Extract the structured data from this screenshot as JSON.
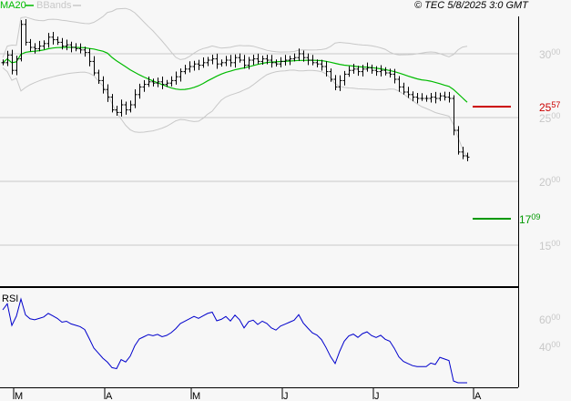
{
  "header": {
    "ma_label": "MA20",
    "bb_label": "BBands",
    "copyright": "© TEC 5/8/2025 3:0 GMT"
  },
  "colors": {
    "ma": "#00bb00",
    "bb": "#c8c8c8",
    "price": "#000000",
    "rsi": "#0000cc",
    "resistance": "#cc0000",
    "support": "#009900"
  },
  "chart_data": {
    "type": "bar",
    "title": "",
    "price_axis": [
      {
        "value": 3000,
        "main": "30",
        "dec": "00"
      },
      {
        "value": 2500,
        "main": "25",
        "dec": "00"
      },
      {
        "value": 2000,
        "main": "20",
        "dec": "00"
      },
      {
        "value": 1500,
        "main": "15",
        "dec": "00"
      }
    ],
    "rsi_axis": [
      {
        "value": 60,
        "main": "60",
        "dec": "00"
      },
      {
        "value": 40,
        "main": "40",
        "dec": "00"
      }
    ],
    "rsi_label": "RSI",
    "months": [
      {
        "label": "M",
        "index": 1
      },
      {
        "label": "A",
        "index": 21
      },
      {
        "label": "M",
        "index": 40
      },
      {
        "label": "J",
        "index": 60
      },
      {
        "label": "J",
        "index": 80
      },
      {
        "label": "A",
        "index": 102
      }
    ],
    "levels": {
      "resistance": {
        "value": 2557,
        "main": "25",
        "dec": "57"
      },
      "support": {
        "value": 1709,
        "main": "17",
        "dec": "09"
      }
    },
    "closes": [
      2930,
      2990,
      2870,
      2960,
      3230,
      3090,
      3050,
      3040,
      3060,
      3080,
      3130,
      3110,
      3090,
      3060,
      3070,
      3050,
      3040,
      3030,
      3010,
      2940,
      2850,
      2790,
      2720,
      2660,
      2560,
      2540,
      2600,
      2560,
      2600,
      2680,
      2740,
      2760,
      2780,
      2770,
      2780,
      2760,
      2770,
      2790,
      2820,
      2860,
      2880,
      2900,
      2920,
      2910,
      2930,
      2950,
      2960,
      2920,
      2930,
      2950,
      2930,
      2970,
      2950,
      2910,
      2950,
      2960,
      2940,
      2960,
      2950,
      2930,
      2920,
      2940,
      2950,
      2960,
      2970,
      3000,
      2970,
      2950,
      2930,
      2920,
      2900,
      2860,
      2800,
      2740,
      2790,
      2840,
      2870,
      2880,
      2860,
      2880,
      2890,
      2870,
      2860,
      2870,
      2850,
      2840,
      2800,
      2740,
      2700,
      2680,
      2660,
      2650,
      2650,
      2650,
      2660,
      2650,
      2670,
      2660,
      2650,
      2400,
      2230,
      2200,
      2190
    ]
  }
}
